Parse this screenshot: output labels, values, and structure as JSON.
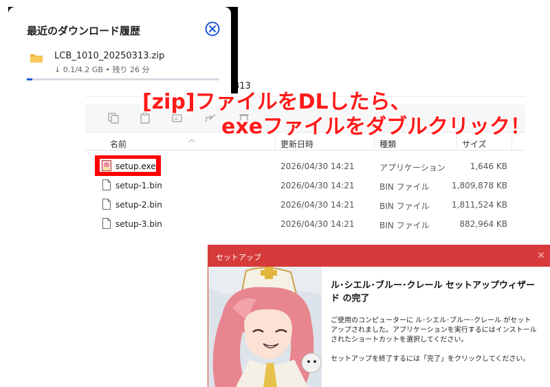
{
  "downloads": {
    "title": "最近のダウンロード履歴",
    "file_name": "LCB_1010_20250313.zip",
    "status": "↓ 0.1/4.2 GB • 残り 26 分",
    "progress_fraction": 0.03
  },
  "explorer": {
    "path_fragment": "313",
    "columns": {
      "name": "名前",
      "date": "更新日時",
      "type": "種類",
      "size": "サイズ"
    },
    "files": [
      {
        "name": "setup.exe",
        "date": "2026/04/30 14:21",
        "type": "アプリケーション",
        "size": "1,646 KB"
      },
      {
        "name": "setup-1.bin",
        "date": "2026/04/30 14:21",
        "type": "BIN ファイル",
        "size": "1,809,878 KB"
      },
      {
        "name": "setup-2.bin",
        "date": "2026/04/30 14:21",
        "type": "BIN ファイル",
        "size": "1,811,524 KB"
      },
      {
        "name": "setup-3.bin",
        "date": "2026/04/30 14:21",
        "type": "BIN ファイル",
        "size": "882,964 KB"
      }
    ]
  },
  "annotation": {
    "line1": "[zip]ファイルをDLしたら、",
    "line2": "exeファイルをダブルクリック！"
  },
  "setup": {
    "title": "セットアップ",
    "heading": "ル･シエル･ブルー･クレール セットアップウィザード の完了",
    "description": "ご使用のコンピューターに ル･シエル･ブルー･クレール がセットアップされました。アプリケーションを実行するにはインストールされたショートカットを選択してください。",
    "finish_text": "セットアップを終了するには「完了」をクリックしてください。"
  },
  "colors": {
    "accent_red": "#ff1a1a",
    "setup_titlebar": "#d63a3a",
    "progress_blue": "#1a57d6"
  }
}
